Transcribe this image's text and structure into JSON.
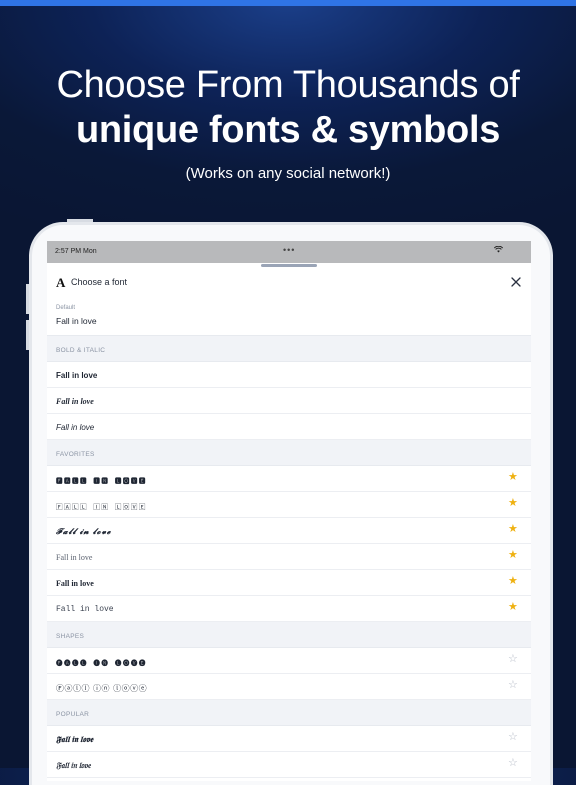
{
  "promo": {
    "headline_line1": "Choose From Thousands of",
    "headline_line2": "unique fonts & symbols",
    "subheadline": "(Works on any social network!)"
  },
  "status_bar": {
    "time": "2:57 PM  Mon",
    "dots": "•••",
    "wifi_icon": "wifi-icon"
  },
  "sheet": {
    "title_icon": "A",
    "title": "Choose a font",
    "close_icon": "close-icon",
    "default_label": "Default",
    "default_value": "Fall in love"
  },
  "sections": [
    {
      "label": "BOLD & ITALIC",
      "rows": [
        {
          "text": "Fall in love",
          "style": "bold"
        },
        {
          "text": "Fall in love",
          "style": "bolditalic"
        },
        {
          "text": "Fall in love",
          "style": "italic"
        }
      ]
    },
    {
      "label": "FAVORITES",
      "rows": [
        {
          "text": "🅵🅰🅻🅻 🅸🅽 🅻🅾🆅🅴",
          "style": "square",
          "star": "filled"
        },
        {
          "text": "🄵🄰🄻🄻 🄸🄽 🄻🄾🅅🄴",
          "style": "outline",
          "star": "filled"
        },
        {
          "text": "𝓕𝓪𝓵𝓵 𝓲𝓷 𝓵𝓸𝓿𝓮",
          "style": "script",
          "star": "filled"
        },
        {
          "text": "Fall in love",
          "style": "serif",
          "star": "filled"
        },
        {
          "text": "Fall in love",
          "style": "serifbold",
          "star": "filled"
        },
        {
          "text": "Fall in love",
          "style": "mono",
          "star": "filled"
        }
      ]
    },
    {
      "label": "SHAPES",
      "rows": [
        {
          "text": "🅕🅐🅛🅛 🅘🅝 🅛🅞🅥🅔",
          "style": "blackcircle",
          "star": "empty"
        },
        {
          "text": "Ⓕⓐⓛⓛ ⓘⓝ ⓛⓞⓥⓔ",
          "style": "circle",
          "star": "empty"
        }
      ]
    },
    {
      "label": "POPULAR",
      "rows": [
        {
          "text": "𝕱𝖆𝖑𝖑 𝖎𝖓 𝖑𝖔𝖛𝖊",
          "style": "gothic",
          "star": "empty"
        },
        {
          "text": "𝔉𝔞𝔩𝔩 𝔦𝔫 𝔩𝔬𝔳𝔢",
          "style": "gothic",
          "star": "empty"
        }
      ]
    }
  ],
  "colors": {
    "background": "#0a1838",
    "accent_bar": "#2f74e6",
    "star_filled": "#efb111",
    "star_empty": "#b6bcc7"
  }
}
